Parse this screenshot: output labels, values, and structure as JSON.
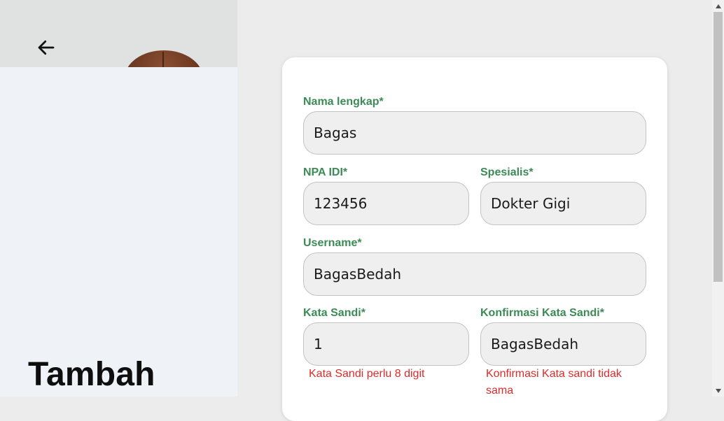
{
  "left_panel": {
    "title": "Tambah"
  },
  "form": {
    "nama_lengkap": {
      "label": "Nama lengkap*",
      "value": "Bagas"
    },
    "npa_idi": {
      "label": "NPA IDI*",
      "value": "123456"
    },
    "spesialis": {
      "label": "Spesialis*",
      "value": "Dokter Gigi"
    },
    "username": {
      "label": "Username*",
      "value": "BagasBedah"
    },
    "kata_sandi": {
      "label": "Kata Sandi*",
      "value": "1",
      "error": "Kata Sandi perlu 8 digit"
    },
    "konfirmasi": {
      "label": "Konfirmasi Kata Sandi*",
      "value": "BagasBedah",
      "error": "Konfirmasi Kata sandi tidak sama"
    }
  },
  "icons": {
    "back": "arrow-left-icon",
    "scroll_up": "triangle-up-icon",
    "scroll_down": "triangle-down-icon"
  },
  "colors": {
    "label_green": "#3c8a55",
    "error_red": "#e02a2a",
    "input_bg": "#efefef"
  }
}
